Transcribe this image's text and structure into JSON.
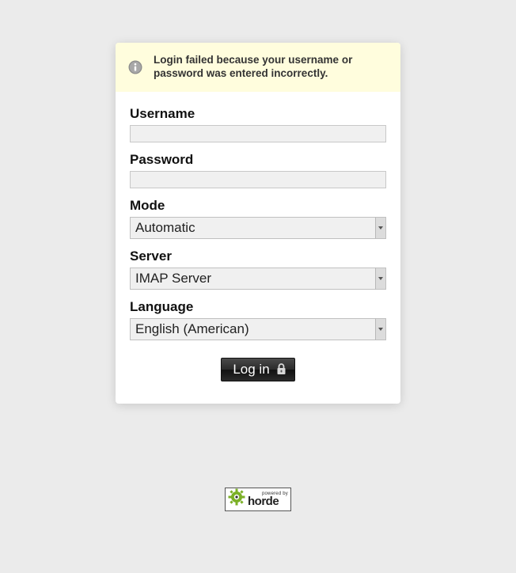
{
  "notice": {
    "message": "Login failed because your username or password was entered incorrectly."
  },
  "form": {
    "username": {
      "label": "Username",
      "value": ""
    },
    "password": {
      "label": "Password",
      "value": ""
    },
    "mode": {
      "label": "Mode",
      "selected": "Automatic"
    },
    "server": {
      "label": "Server",
      "selected": "IMAP Server"
    },
    "language": {
      "label": "Language",
      "selected": "English (American)"
    },
    "submit": {
      "label": "Log in"
    }
  },
  "footer": {
    "powered": "powered by",
    "brand": "horde"
  }
}
